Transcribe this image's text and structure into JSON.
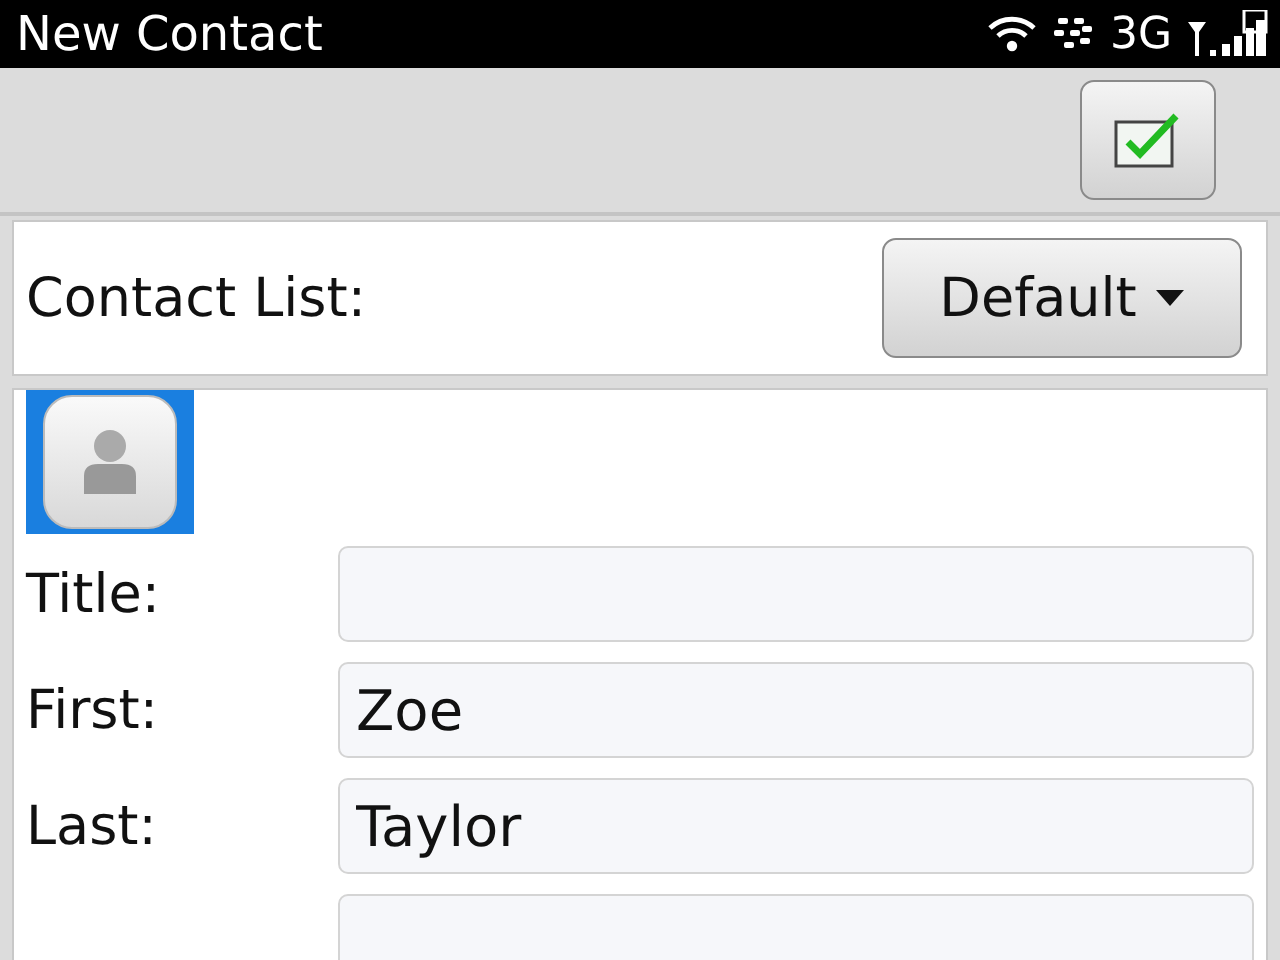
{
  "status_bar": {
    "title": "New Contact",
    "network": "3G"
  },
  "contact_list": {
    "label": "Contact List:",
    "value": "Default"
  },
  "fields": [
    {
      "kind": "text",
      "label": "Title:"
    },
    {
      "kind": "text",
      "label": "First:",
      "value": "Zoe"
    },
    {
      "kind": "text",
      "label": "Last:",
      "value": "Taylor"
    },
    {
      "kind": "text"
    }
  ]
}
